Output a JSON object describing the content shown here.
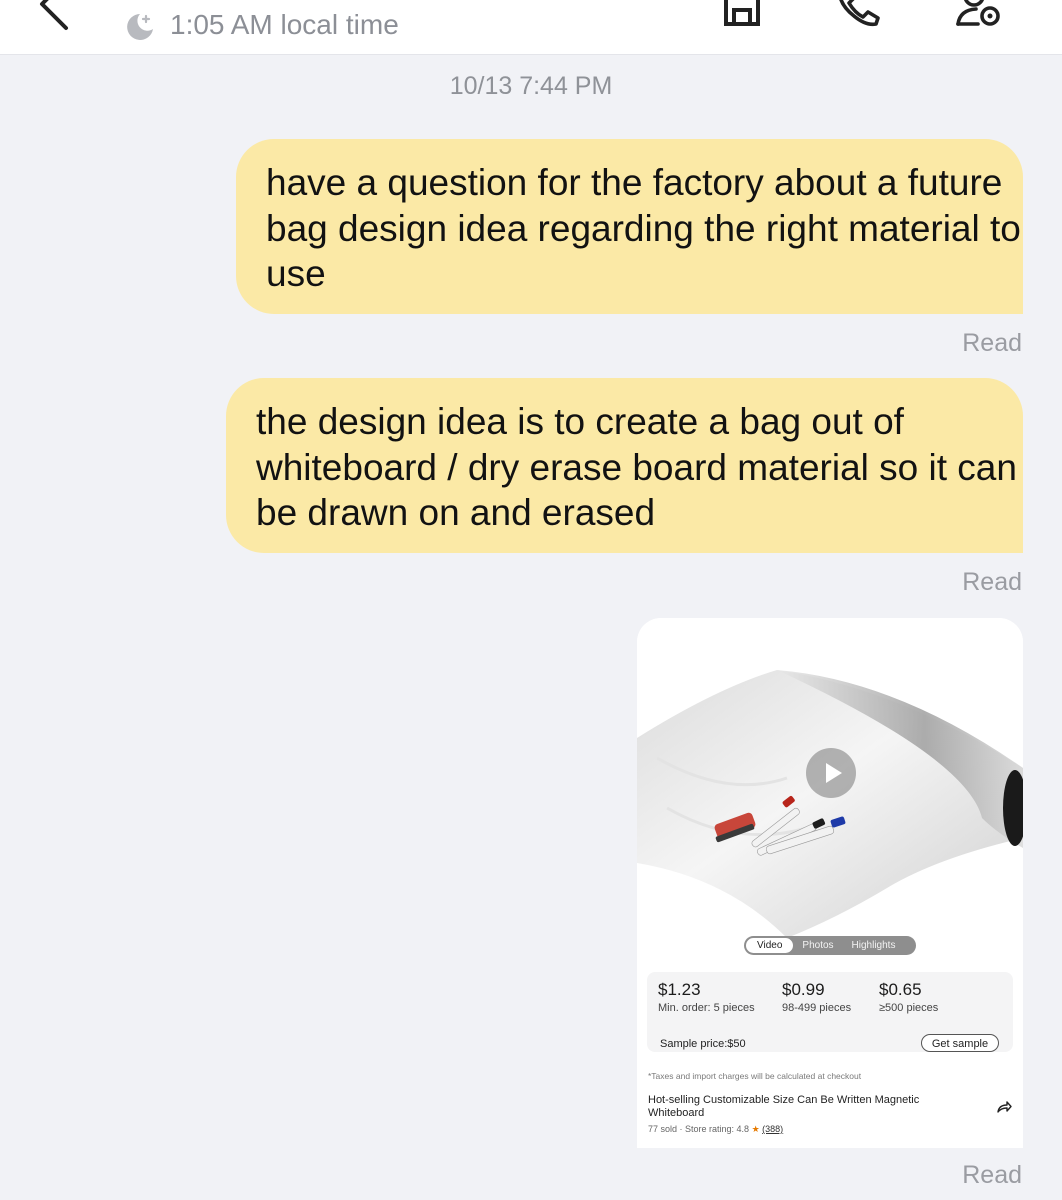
{
  "header": {
    "local_time": "1:05 AM local time"
  },
  "chat": {
    "timestamp": "10/13 7:44 PM",
    "messages": [
      {
        "text": "have a question for the factory about a future bag design idea regarding the right material to use",
        "status": "Read"
      },
      {
        "text": "the design idea is to create a bag out of whiteboard / dry erase board material so it can be drawn on and erased",
        "status": "Read"
      }
    ],
    "product_card": {
      "media_tabs": [
        "Video",
        "Photos",
        "Highlights"
      ],
      "active_tab": "Video",
      "prices": [
        {
          "price": "$1.23",
          "qty": "Min. order: 5 pieces"
        },
        {
          "price": "$0.99",
          "qty": "98-499 pieces"
        },
        {
          "price": "$0.65",
          "qty": "≥500 pieces"
        }
      ],
      "sample_price": "Sample price:$50",
      "get_sample_label": "Get sample",
      "tax_note": "*Taxes and import charges will be calculated at checkout",
      "title": "Hot-selling Customizable Size Can Be Written Magnetic Whiteboard",
      "sold": "77 sold · Store rating: 4.8",
      "star": "★",
      "reviews": "(388)",
      "status": "Read"
    }
  },
  "colors": {
    "bubble": "#fbe9a6",
    "background": "#f1f2f6",
    "rating_star": "#e67a00"
  },
  "icons": [
    "back-arrow-icon",
    "moon-icon",
    "store-icon",
    "phone-icon",
    "profile-settings-icon",
    "play-icon",
    "share-icon"
  ]
}
